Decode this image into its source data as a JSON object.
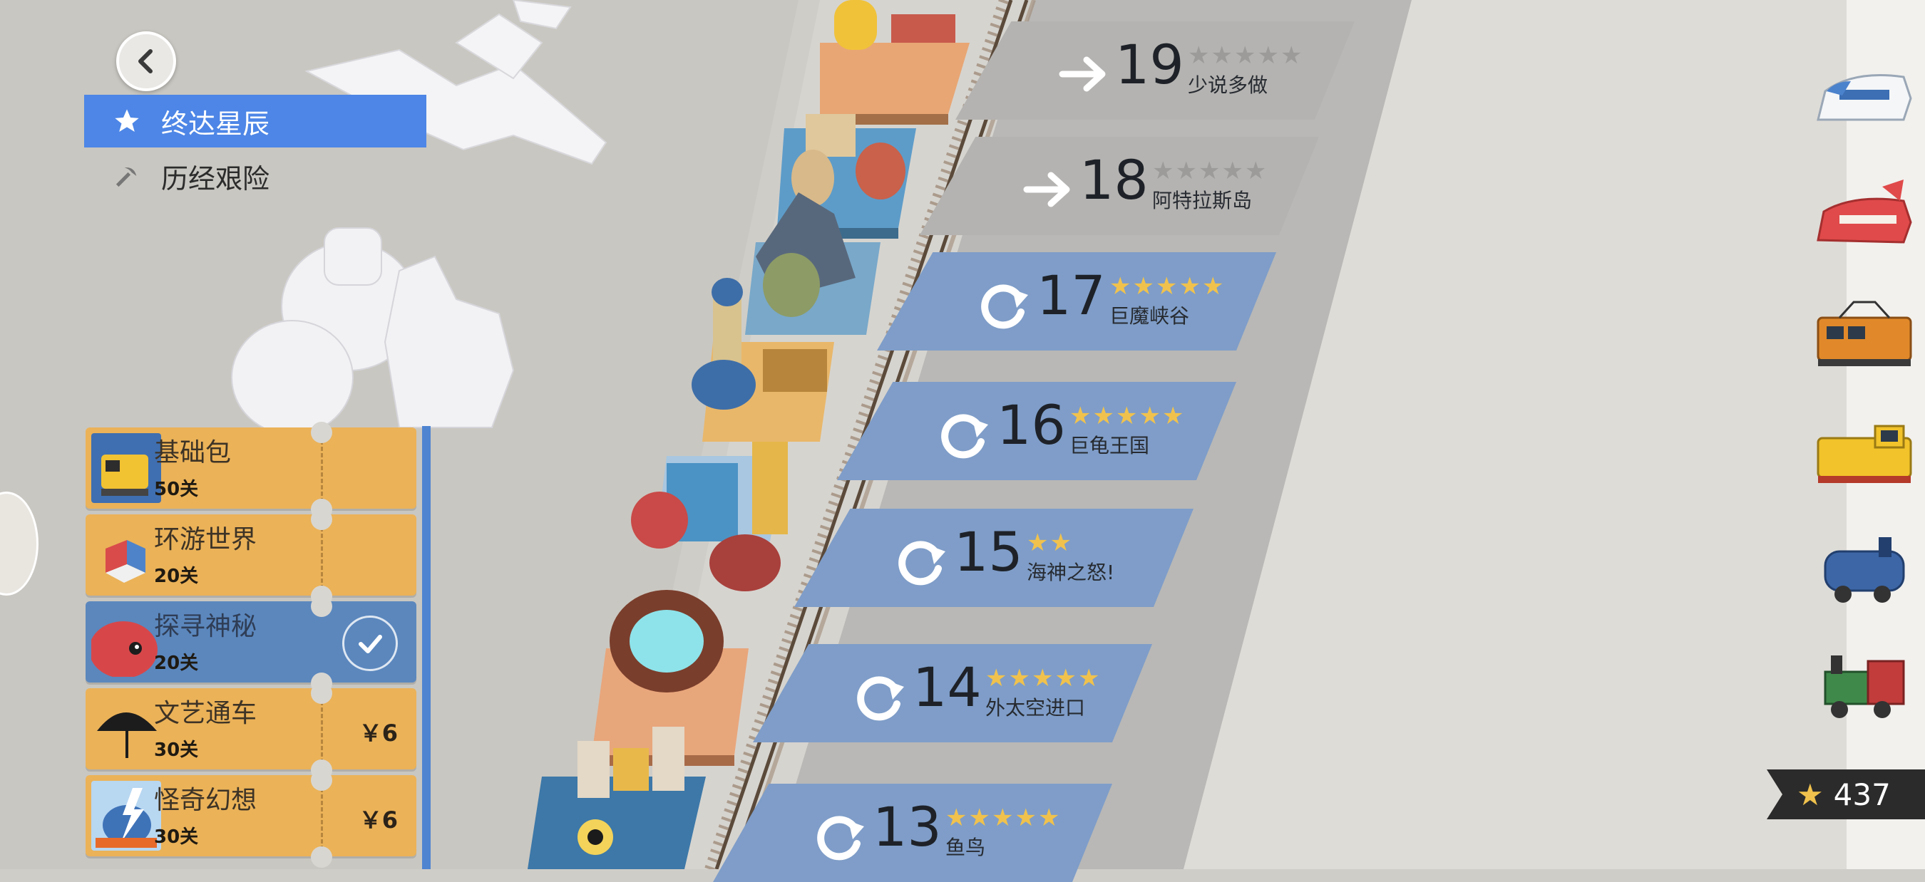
{
  "nav": {
    "back_icon": "chevron-left-icon",
    "items": [
      {
        "label": "终达星辰",
        "icon": "star-icon",
        "active": true
      },
      {
        "label": "历经艰险",
        "icon": "pickaxe-icon",
        "active": false
      }
    ]
  },
  "packs": [
    {
      "name": "基础包",
      "count": "50关",
      "price": "",
      "selected": false,
      "thumb_icon": "yellow-train-icon"
    },
    {
      "name": "环游世界",
      "count": "20关",
      "price": "",
      "selected": false,
      "thumb_icon": "cubes-icon"
    },
    {
      "name": "探寻神秘",
      "count": "20关",
      "price": "",
      "selected": true,
      "thumb_icon": "red-creature-icon"
    },
    {
      "name": "文艺通车",
      "count": "30关",
      "price": "￥6",
      "selected": false,
      "thumb_icon": "umbrella-icon"
    },
    {
      "name": "怪奇幻想",
      "count": "30关",
      "price": "￥6",
      "selected": false,
      "thumb_icon": "lightning-monster-icon"
    }
  ],
  "levels": [
    {
      "number": "19",
      "name": "少说多做",
      "stars": 0,
      "state": "locked",
      "icon": "arrow-right-icon"
    },
    {
      "number": "18",
      "name": "阿特拉斯岛",
      "stars": 0,
      "state": "locked",
      "icon": "arrow-right-icon"
    },
    {
      "number": "17",
      "name": "巨魔峡谷",
      "stars": 5,
      "state": "done",
      "icon": "replay-icon"
    },
    {
      "number": "16",
      "name": "巨龟王国",
      "stars": 5,
      "state": "done",
      "icon": "replay-icon"
    },
    {
      "number": "15",
      "name": "海神之怒!",
      "stars": 2,
      "state": "done",
      "icon": "replay-icon"
    },
    {
      "number": "14",
      "name": "外太空进口",
      "stars": 5,
      "state": "done",
      "icon": "replay-icon"
    },
    {
      "number": "13",
      "name": "鱼鸟",
      "stars": 5,
      "state": "done",
      "icon": "replay-icon"
    }
  ],
  "trains": [
    "bullet-train-icon",
    "red-express-train-icon",
    "orange-electric-train-icon",
    "yellow-diesel-train-icon",
    "blue-steam-train-icon",
    "green-steam-train-icon"
  ],
  "star_total": "437",
  "colors": {
    "nav_active": "#4d86e6",
    "pack_orange": "#ebb258",
    "pack_selected": "#5b87bd",
    "level_done": "#7f9dc8",
    "level_locked": "#b4b3b1",
    "star_gold": "#f0c24d"
  }
}
